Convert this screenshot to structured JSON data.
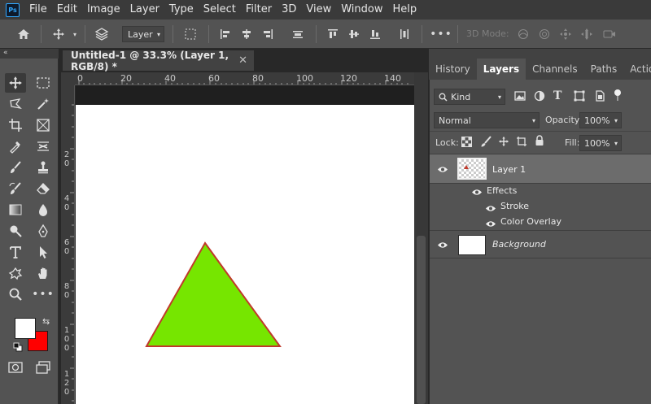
{
  "app": {
    "logo_text": "Ps"
  },
  "menu": [
    "File",
    "Edit",
    "Image",
    "Layer",
    "Type",
    "Select",
    "Filter",
    "3D",
    "View",
    "Window",
    "Help"
  ],
  "options": {
    "auto_select_target": "Layer",
    "mode_3d_label": "3D Mode:"
  },
  "toolbar": {
    "collapse_label": "«"
  },
  "document": {
    "tab_title": "Untitled-1 @ 33.3% (Layer 1, RGB/8) *",
    "close_glyph": "✕",
    "ruler_h": [
      "0",
      "20",
      "40",
      "60",
      "80",
      "100",
      "120",
      "140"
    ],
    "ruler_v": [
      "2 0",
      "4 0",
      "6 0",
      "8 0",
      "1 0 0",
      "1 2 0"
    ],
    "shape": {
      "fill_color": "#76e600",
      "stroke_color": "#c0392b"
    }
  },
  "colors": {
    "foreground": "#ffffff",
    "background": "#ff0000"
  },
  "panel": {
    "tabs": [
      "History",
      "Layers",
      "Channels",
      "Paths",
      "Actions"
    ],
    "active_tab": "Layers",
    "filter_kind": "Kind",
    "blend_mode": "Normal",
    "opacity_label": "Opacity:",
    "opacity_value": "100%",
    "lock_label": "Lock:",
    "fill_label": "Fill:",
    "fill_value": "100%",
    "layers": {
      "layer1": {
        "name": "Layer 1",
        "effects_label": "Effects",
        "effects": [
          "Stroke",
          "Color Overlay"
        ]
      },
      "background": {
        "name": "Background"
      }
    }
  }
}
